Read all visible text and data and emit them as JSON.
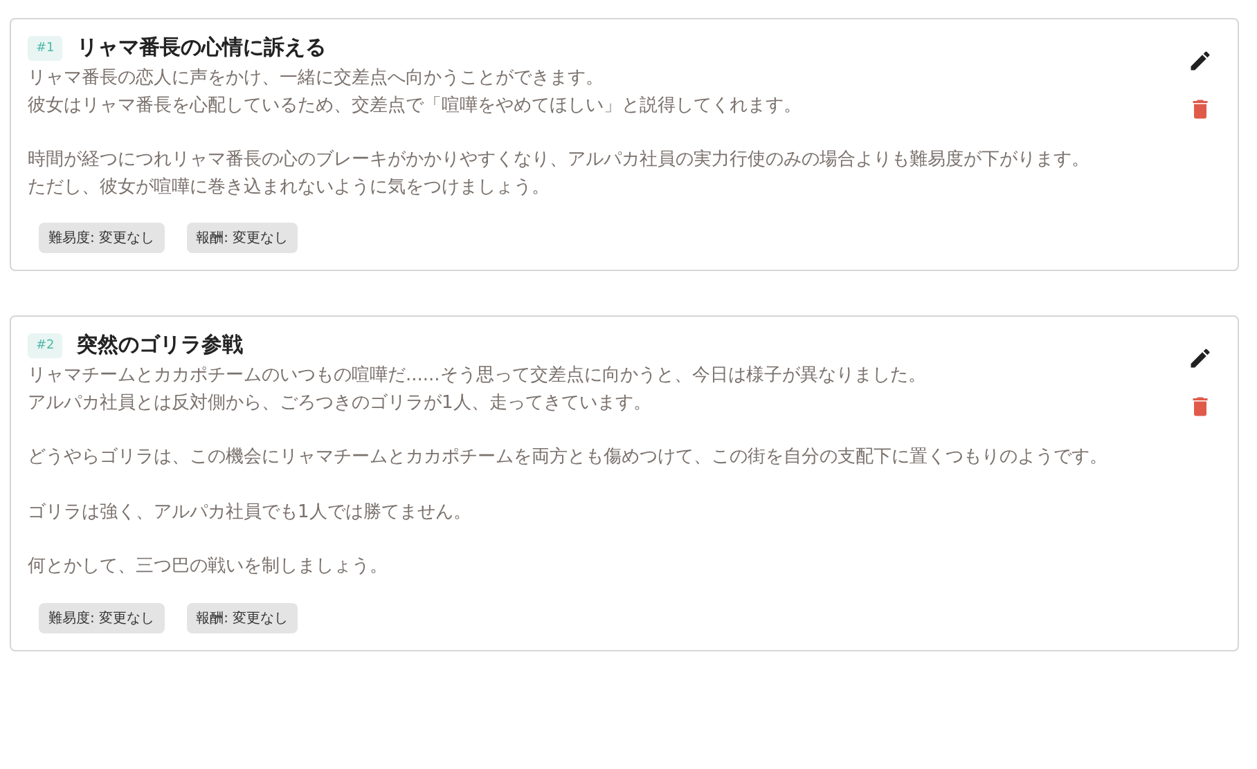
{
  "missions": [
    {
      "number": "#1",
      "title": "リャマ番長の心情に訴える",
      "paragraphs": [
        [
          "リャマ番長の恋人に声をかけ、一緒に交差点へ向かうことができます。",
          "彼女はリャマ番長を心配しているため、交差点で「喧嘩をやめてほしい」と説得してくれます。"
        ],
        [
          "時間が経つにつれリャマ番長の心のブレーキがかかりやすくなり、アルパカ社員の実力行使のみの場合よりも難易度が下がります。",
          "ただし、彼女が喧嘩に巻き込まれないように気をつけましょう。"
        ]
      ],
      "tags": [
        "難易度: 変更なし",
        "報酬: 変更なし"
      ]
    },
    {
      "number": "#2",
      "title": "突然のゴリラ参戦",
      "paragraphs": [
        [
          "リャマチームとカカポチームのいつもの喧嘩だ......そう思って交差点に向かうと、今日は様子が異なりました。",
          "アルパカ社員とは反対側から、ごろつきのゴリラが1人、走ってきています。"
        ],
        [
          "どうやらゴリラは、この機会にリャマチームとカカポチームを両方とも傷めつけて、この街を自分の支配下に置くつもりのようです。"
        ],
        [
          "ゴリラは強く、アルパカ社員でも1人では勝てません。"
        ],
        [
          "何とかして、三つ巴の戦いを制しましょう。"
        ]
      ],
      "tags": [
        "難易度: 変更なし",
        "報酬: 変更なし"
      ]
    }
  ]
}
